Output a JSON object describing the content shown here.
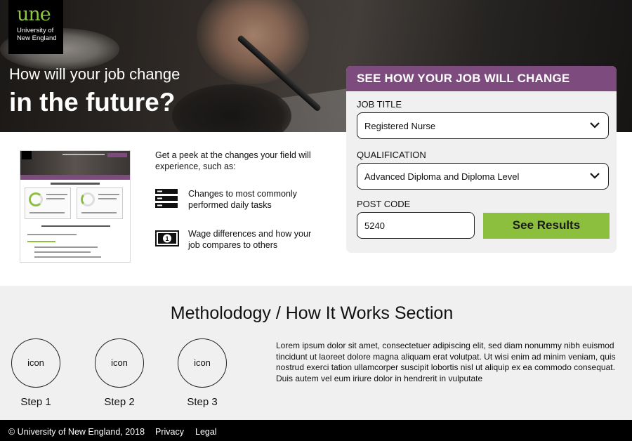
{
  "logo": {
    "mark": "une",
    "line1": "University of",
    "line2": "New England"
  },
  "hero": {
    "subtitle": "How will your job change",
    "title": "in the future?"
  },
  "form": {
    "heading": "SEE HOW YOUR JOB WILL CHANGE",
    "job_title_label": "JOB TITLE",
    "job_title_value": "Registered Nurse",
    "qualification_label": "QUALIFICATION",
    "qualification_value": "Advanced Diploma and Diploma Level",
    "postcode_label": "POST CODE",
    "postcode_value": "5240",
    "submit_label": "See Results",
    "button_color": "#8dbf3e",
    "header_color": "#7e4b7e"
  },
  "features": {
    "intro": "Get a peek at the changes your field will experience, such as:",
    "items": [
      {
        "icon": "list-icon",
        "text": "Changes to most commonly performed daily tasks"
      },
      {
        "icon": "money-icon",
        "text": "Wage differences and how your job compares to others"
      }
    ]
  },
  "methodology": {
    "title": "Metholodogy / How It Works Section",
    "steps": [
      {
        "icon_text": "icon",
        "label": "Step 1"
      },
      {
        "icon_text": "icon",
        "label": "Step 2"
      },
      {
        "icon_text": "icon",
        "label": "Step 3"
      }
    ],
    "body": "Lorem ipsum dolor sit amet, consectetuer adipiscing elit, sed diam nonummy nibh euismod tincidunt ut laoreet dolore magna aliquam erat volutpat. Ut wisi enim ad minim veniam, quis nostrud exerci tation ullamcorper suscipit lobortis nisl ut aliquip ex ea commodo consequat. Duis autem vel eum iriure dolor in hendrerit in vulputate"
  },
  "footer": {
    "copyright": "© University of New England, 2018",
    "privacy": "Privacy",
    "legal": "Legal"
  }
}
